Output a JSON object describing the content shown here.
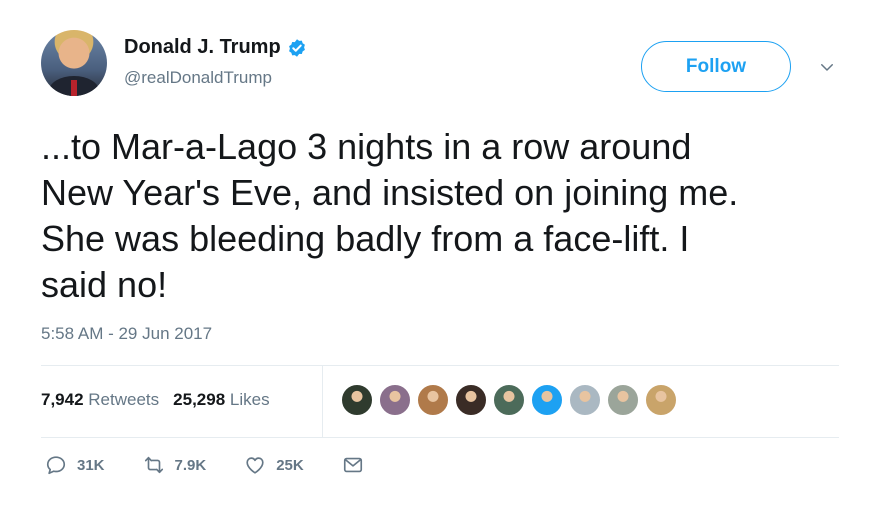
{
  "user": {
    "display_name": "Donald J. Trump",
    "handle": "@realDonaldTrump",
    "verified": true
  },
  "follow_label": "Follow",
  "tweet": {
    "text": "...to Mar-a-Lago 3 nights in a row around\nNew Year's Eve, and insisted on joining me.\nShe was bleeding badly from a face-lift. I\nsaid no!",
    "timestamp": "5:58 AM - 29 Jun 2017"
  },
  "stats": {
    "retweets_count": "7,942",
    "retweets_label": "Retweets",
    "likes_count": "25,298",
    "likes_label": "Likes"
  },
  "likers": [
    "#2f3b2e",
    "#8a6f8c",
    "#b07a4a",
    "#3a2c26",
    "#4c6b5a",
    "#1da1f2",
    "#aab8c2",
    "#9ba59a",
    "#c9a46a"
  ],
  "actions": {
    "reply_count": "31K",
    "retweet_count": "7.9K",
    "like_count": "25K"
  },
  "colors": {
    "accent": "#1da1f2",
    "muted": "#657786",
    "text": "#14171a"
  }
}
